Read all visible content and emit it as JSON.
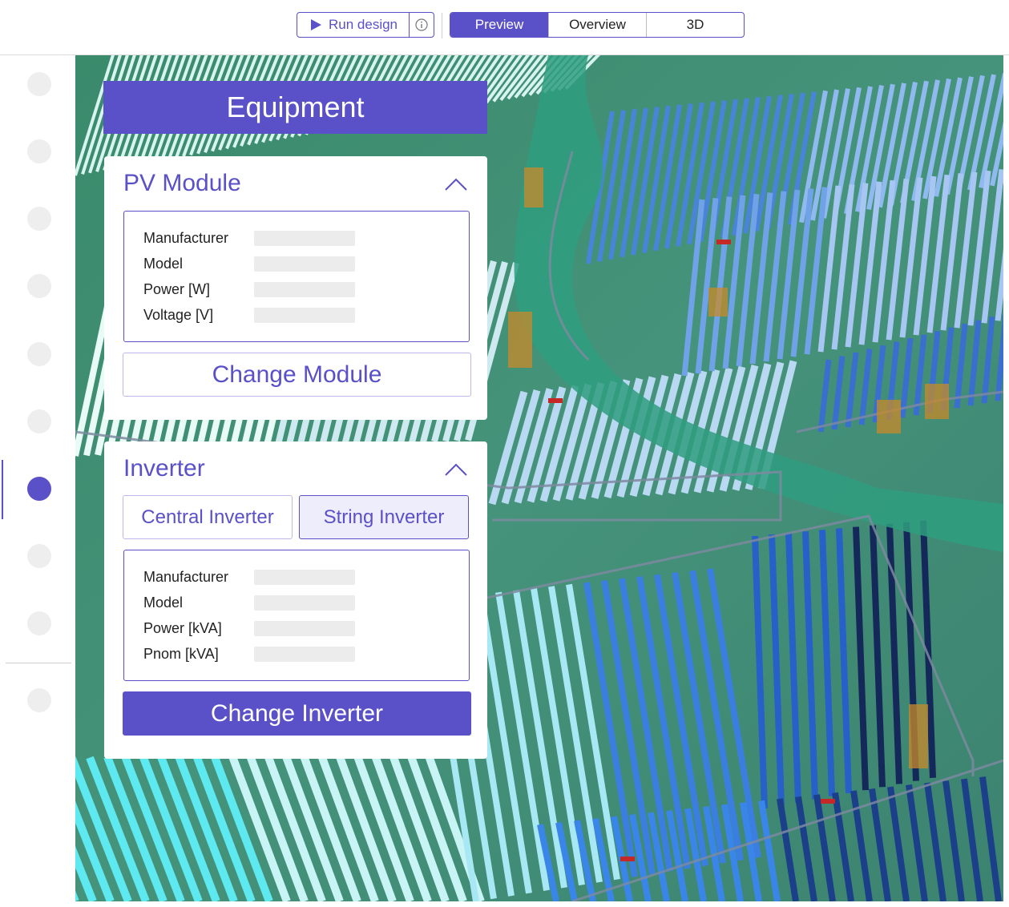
{
  "toolbar": {
    "run_label": "Run design",
    "run_icon": "play-icon",
    "info_icon": "info-icon"
  },
  "view_tabs": [
    {
      "label": "Preview",
      "active": true
    },
    {
      "label": "Overview",
      "active": false
    },
    {
      "label": "3D",
      "active": false
    }
  ],
  "sidebar": {
    "steps": 9,
    "active_step": 7
  },
  "equipment": {
    "title": "Equipment",
    "pv_module": {
      "title": "PV Module",
      "fields": [
        {
          "label": "Manufacturer",
          "value": ""
        },
        {
          "label": "Model",
          "value": ""
        },
        {
          "label": "Power [W]",
          "value": ""
        },
        {
          "label": "Voltage [V]",
          "value": ""
        }
      ],
      "button_label": "Change Module"
    },
    "inverter": {
      "title": "Inverter",
      "types": [
        {
          "label": "Central Inverter",
          "selected": false
        },
        {
          "label": "String Inverter",
          "selected": true
        }
      ],
      "fields": [
        {
          "label": "Manufacturer",
          "value": ""
        },
        {
          "label": "Model",
          "value": ""
        },
        {
          "label": "Power [kVA]",
          "value": ""
        },
        {
          "label": "Pnom [kVA]",
          "value": ""
        }
      ],
      "button_label": "Change Inverter"
    }
  },
  "colors": {
    "accent": "#5a50c8",
    "terrain": "#3f8f75",
    "river": "#2e9b7f"
  }
}
